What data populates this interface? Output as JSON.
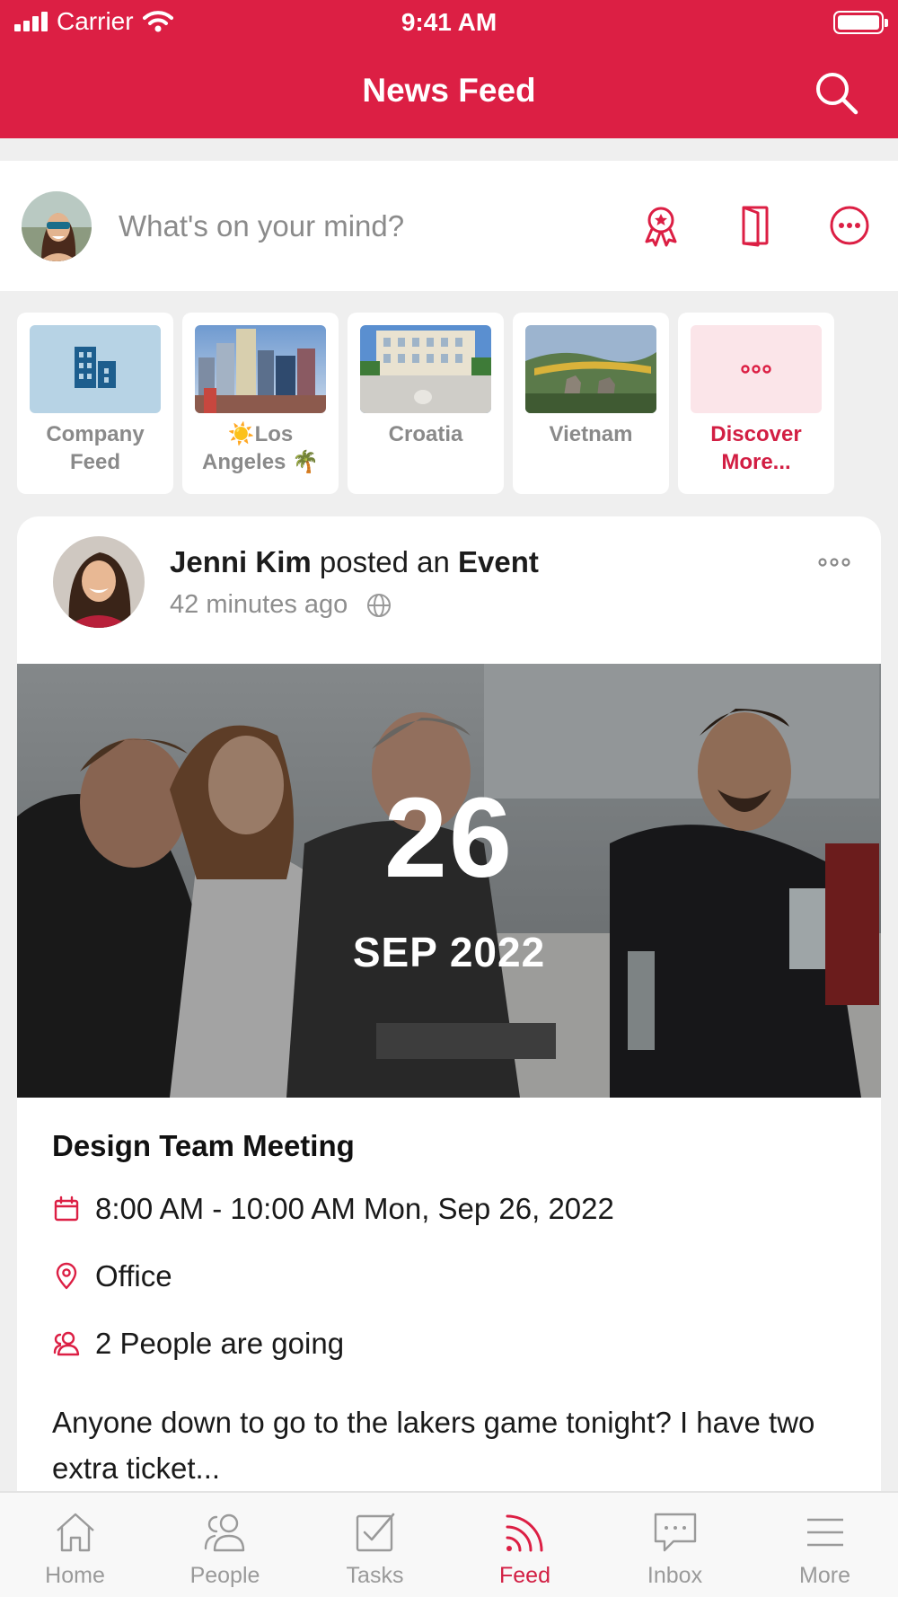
{
  "status_bar": {
    "carrier": "Carrier",
    "time": "9:41 AM"
  },
  "header": {
    "title": "News Feed",
    "search_icon": "search-icon"
  },
  "composer": {
    "placeholder": "What's on your mind?",
    "actions": [
      {
        "icon": "award-ribbon-icon"
      },
      {
        "icon": "door-icon"
      },
      {
        "icon": "more-circle-icon"
      }
    ]
  },
  "categories": [
    {
      "label": "Company Feed",
      "icon": "building-icon"
    },
    {
      "label": "☀️Los Angeles 🌴"
    },
    {
      "label": "Croatia"
    },
    {
      "label": "Vietnam"
    },
    {
      "label": "Discover More...",
      "icon": "dots-icon"
    }
  ],
  "post": {
    "author": "Jenni Kim",
    "action_text": "posted an",
    "action_object": "Event",
    "time_ago": "42 minutes ago",
    "visibility_icon": "globe-icon",
    "event": {
      "day": "26",
      "month_year": "SEP 2022",
      "title": "Design Team Meeting",
      "time": "8:00 AM - 10:00 AM Mon, Sep 26, 2022",
      "location": "Office",
      "attendees": "2 People are going"
    },
    "text": "Anyone down to go to the lakers game tonight? I have two extra ticket..."
  },
  "tabbar": {
    "active": "Feed",
    "items": [
      {
        "label": "Home",
        "icon": "home-icon"
      },
      {
        "label": "People",
        "icon": "people-icon"
      },
      {
        "label": "Tasks",
        "icon": "tasks-icon"
      },
      {
        "label": "Feed",
        "icon": "feed-icon"
      },
      {
        "label": "Inbox",
        "icon": "inbox-icon"
      },
      {
        "label": "More",
        "icon": "menu-icon"
      }
    ]
  },
  "colors": {
    "brand": "#dc1f44",
    "accent_text": "#d21e43",
    "muted": "#8a8a8a"
  }
}
